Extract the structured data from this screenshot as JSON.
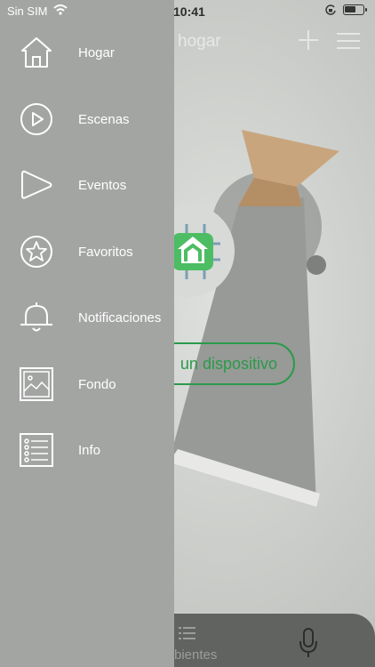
{
  "status_bar": {
    "carrier": "Sin SIM",
    "time": "10:41"
  },
  "background": {
    "title": "hogar",
    "device_button_label": "un dispositivo",
    "bottom_tab_label": "bientes"
  },
  "drawer": {
    "items": [
      {
        "label": "Hogar",
        "icon": "home-icon"
      },
      {
        "label": "Escenas",
        "icon": "play-circle-icon"
      },
      {
        "label": "Eventos",
        "icon": "play-triangle-icon"
      },
      {
        "label": "Favoritos",
        "icon": "star-icon"
      },
      {
        "label": "Notificaciones",
        "icon": "bell-icon"
      },
      {
        "label": "Fondo",
        "icon": "picture-icon"
      },
      {
        "label": "Info",
        "icon": "list-icon"
      }
    ]
  },
  "colors": {
    "drawer_bg": "#a3a5a3",
    "accent_green": "#2a9a4b",
    "bottom_bar": "#616361"
  }
}
